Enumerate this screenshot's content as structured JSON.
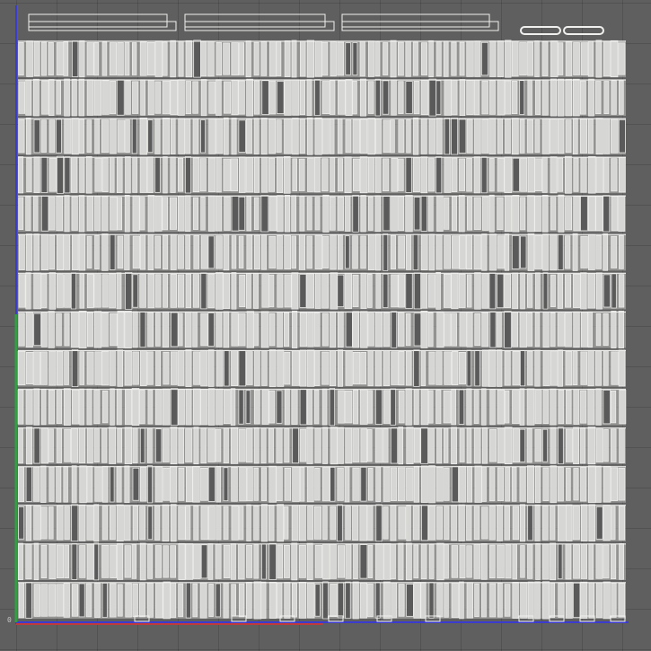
{
  "viewport": {
    "view": "uv-wireframe",
    "background_color": "#5f5f5f",
    "grid_color": "#545454",
    "wire_color": "#d6d6d4",
    "wire_stroke_color": "#f0f0ee"
  },
  "axes": {
    "x_axis_color": "#c13a3a",
    "y_axis_color": "#2fa140",
    "frame_axis_color": "#3b3bd0",
    "origin_label": "0"
  },
  "uv_island_grid": {
    "rows": 15,
    "columns": 80
  },
  "top_strips": {
    "count": 3,
    "pill_count": 2
  }
}
